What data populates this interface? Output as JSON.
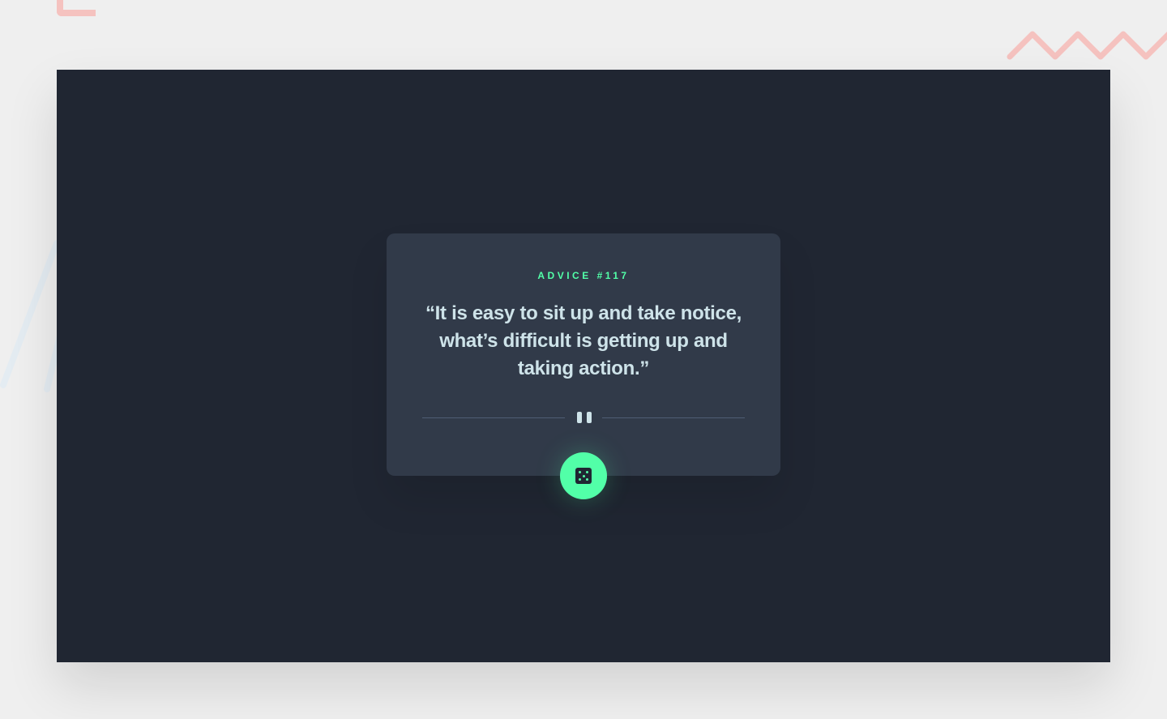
{
  "advice": {
    "label": "ADVICE #117",
    "quote": "“It is easy to sit up and take notice, what’s difficult is getting up and taking action.”"
  },
  "icons": {
    "divider": "pause-icon",
    "button": "dice-icon"
  },
  "colors": {
    "page_background": "#efefef",
    "frame_background": "#202632",
    "card_background": "#313a49",
    "accent": "#52ffa8",
    "quote_text": "#cee3e9",
    "decoration": "#f5c2bf"
  }
}
